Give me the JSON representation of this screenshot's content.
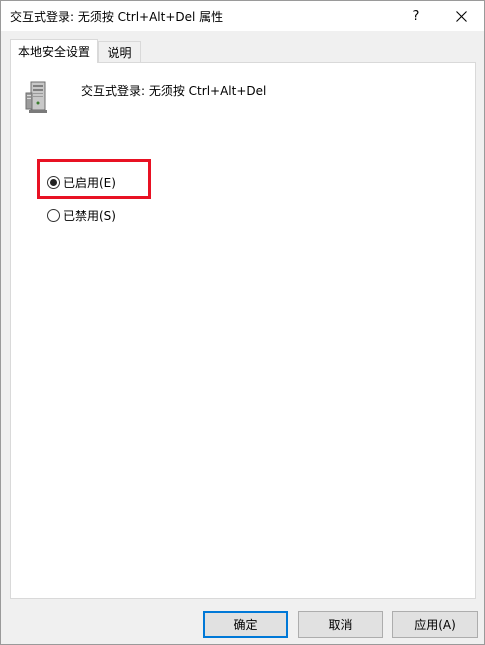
{
  "window": {
    "title": "交互式登录: 无须按 Ctrl+Alt+Del 属性",
    "help_label": "?"
  },
  "tabs": [
    {
      "label": "本地安全设置",
      "active": true
    },
    {
      "label": "说明",
      "active": false
    }
  ],
  "policy": {
    "name": "交互式登录: 无须按 Ctrl+Alt+Del",
    "icon": "server-icon"
  },
  "options": {
    "enabled_label": "已启用(E)",
    "disabled_label": "已禁用(S)",
    "selected": "enabled"
  },
  "highlight_color": "#e81123",
  "buttons": {
    "ok": "确定",
    "cancel": "取消",
    "apply": "应用(A)"
  }
}
